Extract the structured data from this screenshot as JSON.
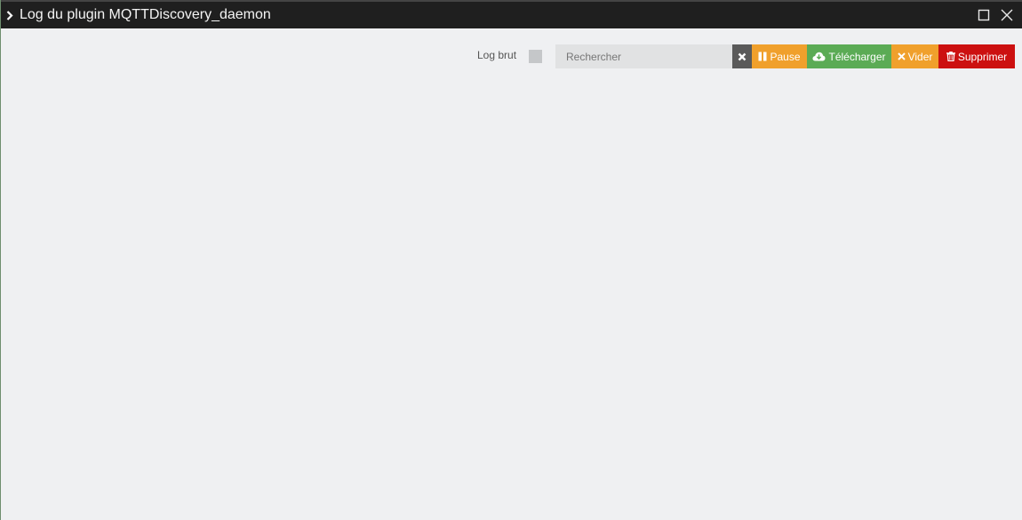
{
  "window": {
    "title": "Log du plugin MQTTDiscovery_daemon"
  },
  "toolbar": {
    "raw_log_label": "Log brut",
    "search_placeholder": "Rechercher",
    "pause_label": "Pause",
    "download_label": "Télécharger",
    "empty_label": "Vider",
    "delete_label": "Supprimer"
  },
  "colors": {
    "titlebar": "#1f1f1f",
    "content_bg": "#eff0f2",
    "pause": "#f0a02c",
    "download": "#5bab55",
    "empty": "#f0a02c",
    "delete": "#cc1010",
    "clear": "#5a5a5a"
  },
  "icons": {
    "title": "chevron-right-icon",
    "maximize": "maximize-icon",
    "close": "close-icon",
    "clear": "close-icon",
    "pause": "pause-icon",
    "download": "cloud-download-icon",
    "empty": "close-icon",
    "delete": "trash-icon"
  }
}
